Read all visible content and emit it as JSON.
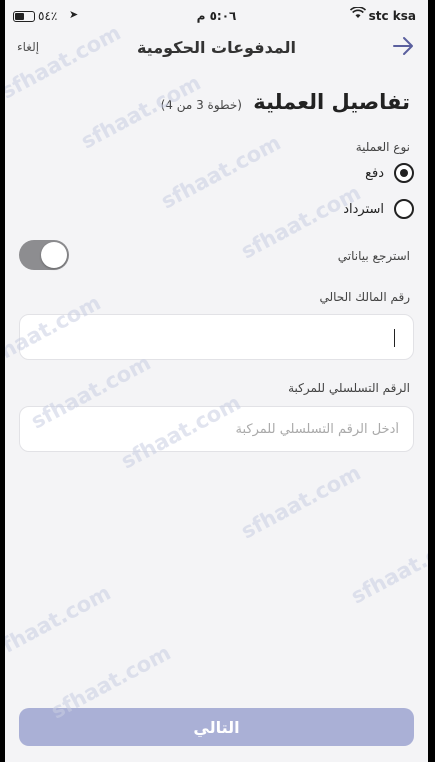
{
  "status_bar": {
    "carrier": "stc ksa",
    "time": "٥:٠٦ م",
    "battery": "٥٤٪"
  },
  "nav": {
    "title": "المدفوعات الحكومية",
    "cancel_label": "إلغاء"
  },
  "page": {
    "heading": "تفاصيل العملية",
    "step": "(خطوة 3 من 4)"
  },
  "operation_type": {
    "label": "نوع العملية",
    "options": [
      {
        "label": "دفع",
        "selected": true
      },
      {
        "label": "استرداد",
        "selected": false
      }
    ]
  },
  "retrieve_data": {
    "label": "استرجع بياناتي",
    "enabled": true
  },
  "owner_id": {
    "label": "رقم المالك الحالي",
    "value": "",
    "placeholder": ""
  },
  "serial_number": {
    "label": "الرقم التسلسلي للمركبة",
    "value": "",
    "placeholder": "أدخل الرقم التسلسلي للمركبة"
  },
  "next_button": {
    "label": "التالي"
  },
  "watermark": "sfhaat.com",
  "colors": {
    "background": "#f4f4f6",
    "button_disabled": "#aab0d6",
    "toggle_on": "#8d8d90"
  }
}
